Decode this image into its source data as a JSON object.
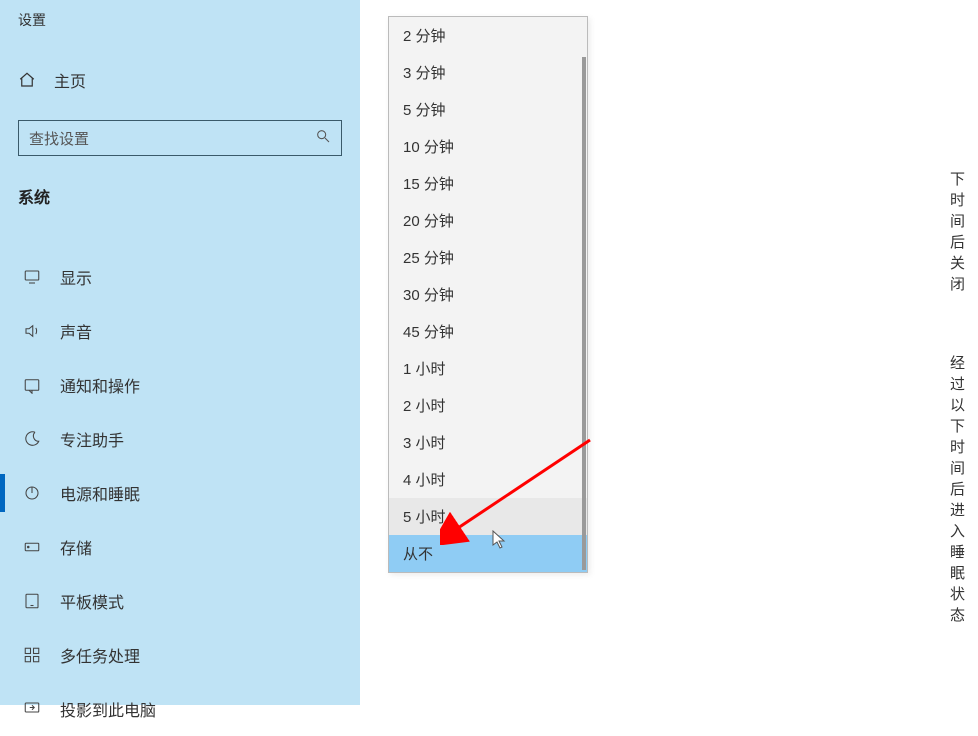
{
  "sidebar": {
    "title": "设置",
    "home_label": "主页",
    "search_placeholder": "查找设置",
    "section_label": "系统",
    "items": [
      {
        "label": "显示",
        "icon": "display"
      },
      {
        "label": "声音",
        "icon": "sound"
      },
      {
        "label": "通知和操作",
        "icon": "notification"
      },
      {
        "label": "专注助手",
        "icon": "moon"
      },
      {
        "label": "电源和睡眠",
        "icon": "power",
        "selected": true
      },
      {
        "label": "存储",
        "icon": "storage"
      },
      {
        "label": "平板模式",
        "icon": "tablet"
      },
      {
        "label": "多任务处理",
        "icon": "multitask"
      },
      {
        "label": "投影到此电脑",
        "icon": "project"
      }
    ]
  },
  "content": {
    "hint1": "下时间后关闭",
    "hint2": "经过以下时间后进入睡眠状态"
  },
  "dropdown": {
    "items": [
      {
        "label": "2 分钟"
      },
      {
        "label": "3 分钟"
      },
      {
        "label": "5 分钟"
      },
      {
        "label": "10 分钟"
      },
      {
        "label": "15 分钟"
      },
      {
        "label": "20 分钟"
      },
      {
        "label": "25 分钟"
      },
      {
        "label": "30 分钟"
      },
      {
        "label": "45 分钟"
      },
      {
        "label": "1 小时"
      },
      {
        "label": "2 小时"
      },
      {
        "label": "3 小时"
      },
      {
        "label": "4 小时"
      },
      {
        "label": "5 小时",
        "hover": true
      },
      {
        "label": "从不",
        "selected": true
      }
    ]
  }
}
